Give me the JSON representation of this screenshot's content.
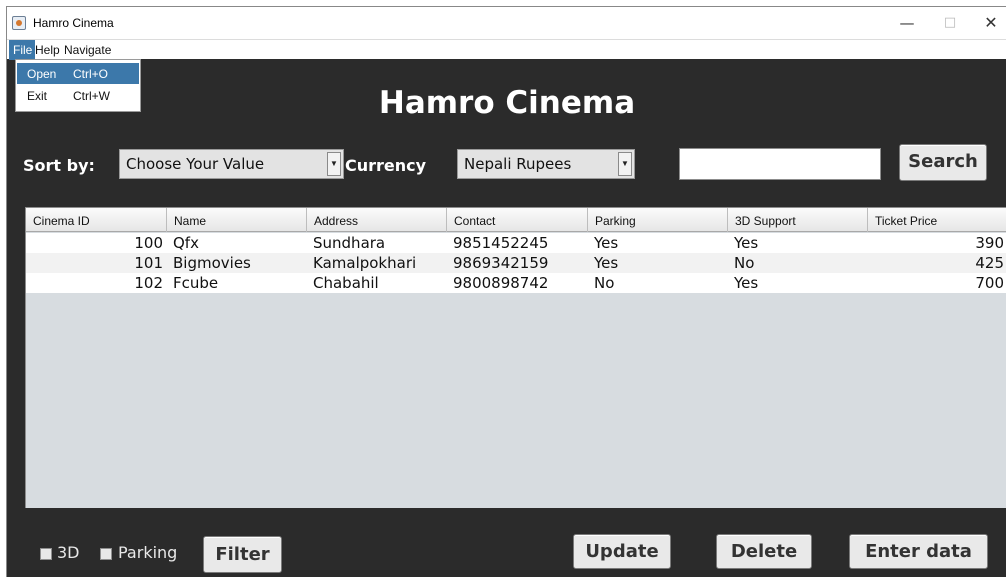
{
  "window": {
    "title": "Hamro Cinema",
    "minimize": "—",
    "maximize": "□",
    "close": "✕"
  },
  "menubar": {
    "file": "File",
    "help": "Help",
    "navigate": "Navigate"
  },
  "file_menu": {
    "open": {
      "label": "Open",
      "accel": "Ctrl+O"
    },
    "exit": {
      "label": "Exit",
      "accel": "Ctrl+W"
    }
  },
  "heading": "Hamro Cinema",
  "controls": {
    "sort_label": "Sort by:",
    "sort_value": "Choose Your Value",
    "currency_label": "Currency",
    "currency_value": "Nepali Rupees",
    "search_value": "",
    "search_button": "Search"
  },
  "table": {
    "columns": [
      "Cinema ID",
      "Name",
      "Address",
      "Contact",
      "Parking",
      "3D Support",
      "Ticket Price"
    ],
    "rows": [
      [
        "100",
        "Qfx",
        "Sundhara",
        "9851452245",
        "Yes",
        "Yes",
        "390"
      ],
      [
        "101",
        "Bigmovies",
        "Kamalpokhari",
        "9869342159",
        "Yes",
        "No",
        "425"
      ],
      [
        "102",
        "Fcube",
        "Chabahil",
        "9800898742",
        "No",
        "Yes",
        "700"
      ]
    ]
  },
  "bottom": {
    "check_3d": "3D",
    "check_parking": "Parking",
    "filter": "Filter",
    "update": "Update",
    "delete": "Delete",
    "enter_data": "Enter data"
  },
  "colors": {
    "background": "#2b2b2b",
    "menu_highlight": "#3c78aa",
    "table_empty": "#d7dce0"
  }
}
